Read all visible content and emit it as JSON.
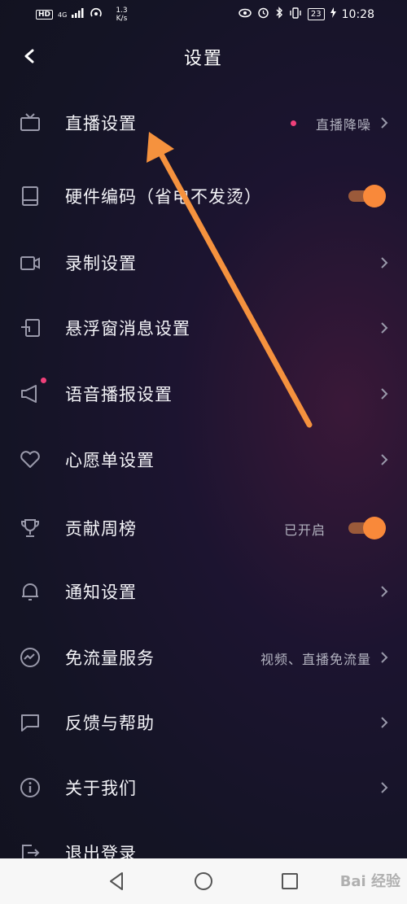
{
  "status_bar": {
    "hd": "HD",
    "signal": "4G",
    "speed_value": "1.3",
    "speed_unit": "K/s",
    "battery": "23",
    "time": "10:28"
  },
  "header": {
    "title": "设置"
  },
  "rows": [
    {
      "label": "直播设置",
      "value": "直播降噪",
      "has_dot": true,
      "control": "chevron",
      "icon": "tv-icon"
    },
    {
      "label": "硬件编码（省电不发烫）",
      "value": "",
      "control": "toggle",
      "toggle_on": true,
      "icon": "chip-icon"
    },
    {
      "label": "录制设置",
      "value": "",
      "control": "chevron",
      "icon": "video-camera-icon"
    },
    {
      "label": "悬浮窗消息设置",
      "value": "",
      "control": "chevron",
      "icon": "floating-window-icon"
    },
    {
      "label": "语音播报设置",
      "value": "",
      "control": "chevron",
      "icon": "speaker-icon",
      "icon_dot": true
    },
    {
      "label": "心愿单设置",
      "value": "",
      "control": "chevron",
      "icon": "heart-icon"
    },
    {
      "label": "贡献周榜",
      "value": "已开启",
      "control": "toggle",
      "toggle_on": true,
      "icon": "trophy-icon"
    },
    {
      "label": "通知设置",
      "value": "",
      "control": "chevron",
      "icon": "bell-icon"
    },
    {
      "label": "免流量服务",
      "value": "视频、直播免流量",
      "control": "chevron",
      "icon": "data-flow-icon"
    },
    {
      "label": "反馈与帮助",
      "value": "",
      "control": "chevron",
      "icon": "chat-icon"
    },
    {
      "label": "关于我们",
      "value": "",
      "control": "chevron",
      "icon": "info-icon"
    },
    {
      "label": "退出登录",
      "value": "",
      "control": "none",
      "icon": "logout-icon"
    }
  ],
  "watermark": "Bai 经验",
  "colors": {
    "accent": "#f9893a",
    "dot": "#f0407a",
    "annotation_arrow": "#f5923e"
  }
}
